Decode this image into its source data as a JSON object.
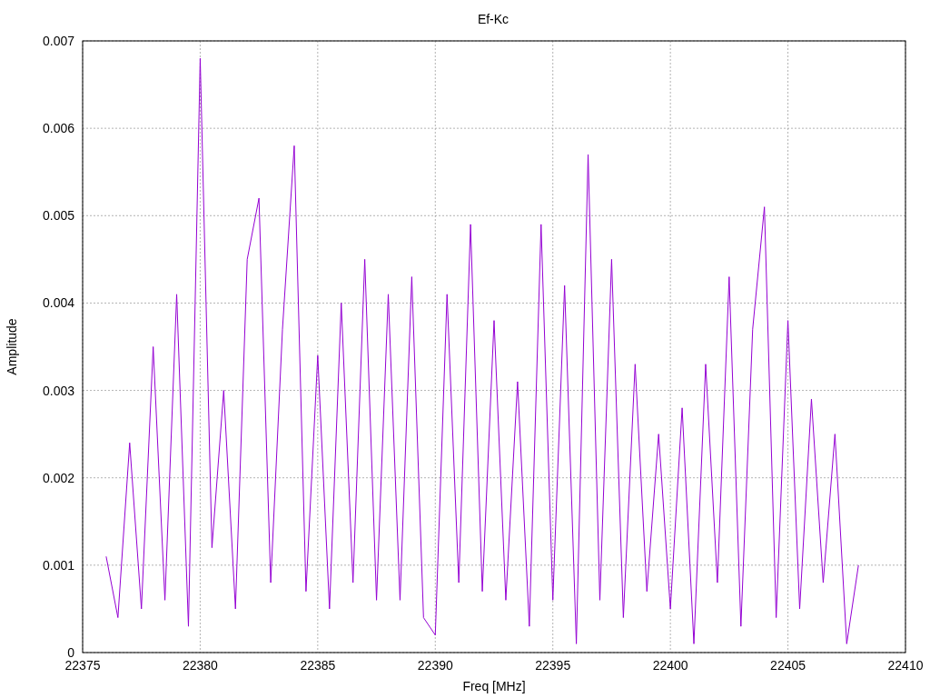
{
  "chart_data": {
    "type": "line",
    "grid": true,
    "title": "Ef-Kc",
    "xlabel": "Freq [MHz]",
    "ylabel": "Amplitude",
    "xlim": [
      22375,
      22410
    ],
    "ylim": [
      0,
      0.007
    ],
    "xticks": [
      22375,
      22380,
      22385,
      22390,
      22395,
      22400,
      22405,
      22410
    ],
    "yticks": [
      {
        "value": 0,
        "label": "0"
      },
      {
        "value": 0.001,
        "label": "0.001"
      },
      {
        "value": 0.002,
        "label": "0.002"
      },
      {
        "value": 0.003,
        "label": "0.003"
      },
      {
        "value": 0.004,
        "label": "0.004"
      },
      {
        "value": 0.005,
        "label": "0.005"
      },
      {
        "value": 0.006,
        "label": "0.006"
      },
      {
        "value": 0.007,
        "label": "0.007"
      }
    ],
    "x": [
      22376,
      22376.5,
      22377,
      22377.5,
      22378,
      22378.5,
      22379,
      22379.5,
      22380,
      22380.5,
      22381,
      22381.5,
      22382,
      22382.5,
      22383,
      22383.5,
      22384,
      22384.5,
      22385,
      22385.5,
      22386,
      22386.5,
      22387,
      22387.5,
      22388,
      22388.5,
      22389,
      22389.5,
      22390,
      22390.5,
      22391,
      22391.5,
      22392,
      22392.5,
      22393,
      22393.5,
      22394,
      22394.5,
      22395,
      22395.5,
      22396,
      22396.5,
      22397,
      22397.5,
      22398,
      22398.5,
      22399,
      22399.5,
      22400,
      22400.5,
      22401,
      22401.5,
      22402,
      22402.5,
      22403,
      22403.5,
      22404,
      22404.5,
      22405,
      22405.5,
      22406,
      22406.5,
      22407,
      22407.5,
      22408
    ],
    "series": [
      {
        "color": "#9400d3",
        "values": [
          0.0011,
          0.0004,
          0.0024,
          0.0005,
          0.0035,
          0.0006,
          0.0041,
          0.0003,
          0.0068,
          0.0012,
          0.003,
          0.0005,
          0.0045,
          0.0052,
          0.0008,
          0.0037,
          0.0058,
          0.0007,
          0.0034,
          0.0005,
          0.004,
          0.0008,
          0.0045,
          0.0006,
          0.0041,
          0.0006,
          0.0043,
          0.0004,
          0.0002,
          0.0041,
          0.0008,
          0.0049,
          0.0007,
          0.0038,
          0.0006,
          0.0031,
          0.0003,
          0.0049,
          0.0006,
          0.0042,
          0.0001,
          0.0057,
          0.0006,
          0.0045,
          0.0004,
          0.0033,
          0.0007,
          0.0025,
          0.0005,
          0.0028,
          0.0001,
          0.0033,
          0.0008,
          0.0043,
          0.0003,
          0.0037,
          0.0051,
          0.0004,
          0.0038,
          0.0005,
          0.0029,
          0.0008,
          0.0025,
          0.0001,
          0.001
        ]
      }
    ]
  }
}
